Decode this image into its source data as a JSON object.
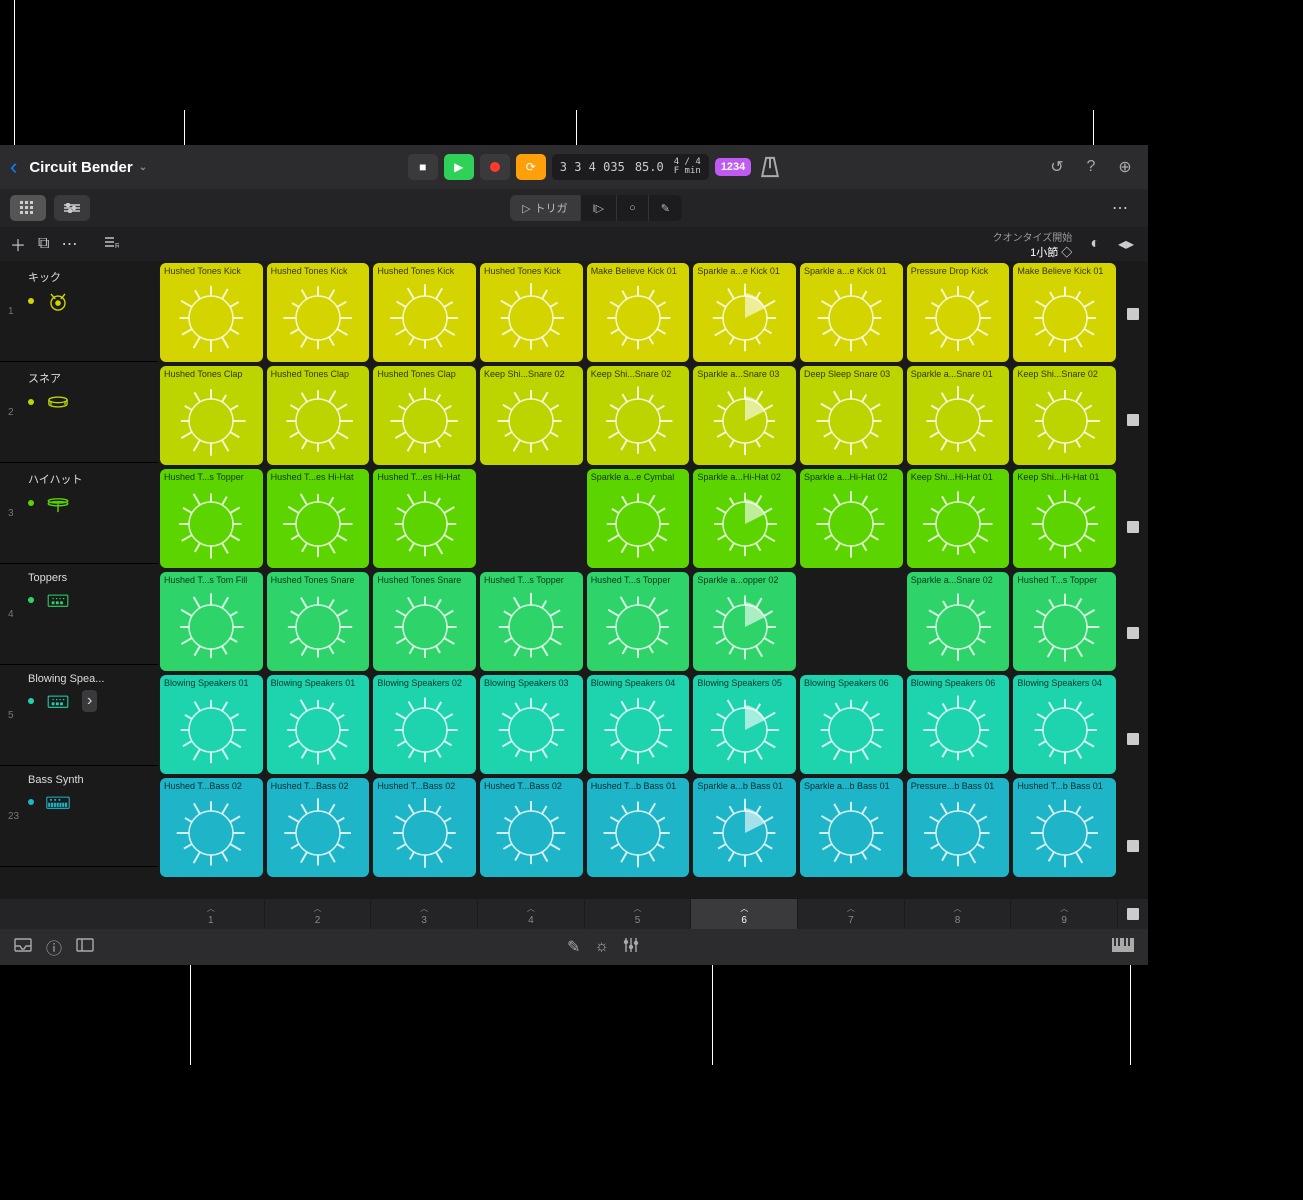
{
  "project": {
    "title": "Circuit Bender"
  },
  "transport": {
    "position": "3 3 4 035",
    "tempo": "85.0",
    "timesig": "4 / 4",
    "key": "F min",
    "countin": "1234"
  },
  "modes": {
    "trigger": "トリガ"
  },
  "quantize": {
    "label": "クオンタイズ開始",
    "value": "1小節"
  },
  "tracks": [
    {
      "num": "1",
      "name": "キック",
      "color": "#d4d400",
      "icon": "kick"
    },
    {
      "num": "2",
      "name": "スネア",
      "color": "#bcd400",
      "icon": "snare"
    },
    {
      "num": "3",
      "name": "ハイハット",
      "color": "#5cd400",
      "icon": "hihat"
    },
    {
      "num": "4",
      "name": "Toppers",
      "color": "#2ed46a",
      "icon": "pad"
    },
    {
      "num": "5",
      "name": "Blowing Spea...",
      "color": "#1ed4af",
      "icon": "pad",
      "expand": true
    },
    {
      "num": "23",
      "name": "Bass Synth",
      "color": "#1eb5c8",
      "icon": "synth"
    }
  ],
  "grid": [
    {
      "color": "#d4d400",
      "cells": [
        {
          "l": "Hushed Tones Kick"
        },
        {
          "l": "Hushed Tones Kick"
        },
        {
          "l": "Hushed Tones Kick"
        },
        {
          "l": "Hushed Tones Kick"
        },
        {
          "l": "Make Believe Kick 01"
        },
        {
          "l": "Sparkle a...e Kick 01",
          "play": true
        },
        {
          "l": "Sparkle a...e Kick 01"
        },
        {
          "l": "Pressure Drop Kick"
        },
        {
          "l": "Make Believe Kick 01"
        }
      ]
    },
    {
      "color": "#bcd400",
      "cells": [
        {
          "l": "Hushed Tones Clap"
        },
        {
          "l": "Hushed Tones Clap"
        },
        {
          "l": "Hushed Tones Clap"
        },
        {
          "l": "Keep Shi...Snare 02"
        },
        {
          "l": "Keep Shi...Snare 02"
        },
        {
          "l": "Sparkle a...Snare 03",
          "play": true
        },
        {
          "l": "Deep Sleep Snare 03"
        },
        {
          "l": "Sparkle a...Snare 01"
        },
        {
          "l": "Keep Shi...Snare 02"
        }
      ]
    },
    {
      "color": "#5cd400",
      "cells": [
        {
          "l": "Hushed T...s Topper"
        },
        {
          "l": "Hushed T...es Hi-Hat"
        },
        {
          "l": "Hushed T...es Hi-Hat"
        },
        {
          "empty": true
        },
        {
          "l": "Sparkle a...e Cymbal"
        },
        {
          "l": "Sparkle a...Hi-Hat 02",
          "play": true
        },
        {
          "l": "Sparkle a...Hi-Hat 02"
        },
        {
          "l": "Keep Shi...Hi-Hat 01"
        },
        {
          "l": "Keep Shi...Hi-Hat 01"
        }
      ]
    },
    {
      "color": "#2ed46a",
      "cells": [
        {
          "l": "Hushed T...s Tom Fill"
        },
        {
          "l": "Hushed Tones Snare"
        },
        {
          "l": "Hushed Tones Snare"
        },
        {
          "l": "Hushed T...s Topper"
        },
        {
          "l": "Hushed T...s Topper"
        },
        {
          "l": "Sparkle a...opper 02",
          "play": true
        },
        {
          "empty": true
        },
        {
          "l": "Sparkle a...Snare 02"
        },
        {
          "l": "Hushed T...s Topper"
        }
      ]
    },
    {
      "color": "#1ed4af",
      "cells": [
        {
          "l": "Blowing Speakers 01"
        },
        {
          "l": "Blowing Speakers 01"
        },
        {
          "l": "Blowing Speakers 02"
        },
        {
          "l": "Blowing Speakers 03"
        },
        {
          "l": "Blowing Speakers 04"
        },
        {
          "l": "Blowing Speakers 05",
          "play": true
        },
        {
          "l": "Blowing Speakers 06"
        },
        {
          "l": "Blowing Speakers 06"
        },
        {
          "l": "Blowing Speakers 04"
        }
      ]
    },
    {
      "color": "#1eb5c8",
      "cells": [
        {
          "l": "Hushed T...Bass 02"
        },
        {
          "l": "Hushed T...Bass 02"
        },
        {
          "l": "Hushed T...Bass 02"
        },
        {
          "l": "Hushed T...Bass 02"
        },
        {
          "l": "Hushed T...b Bass 01"
        },
        {
          "l": "Sparkle a...b Bass 01",
          "play": true
        },
        {
          "l": "Sparkle a...b Bass 01"
        },
        {
          "l": "Pressure...b Bass 01"
        },
        {
          "l": "Hushed T...b Bass 01"
        }
      ]
    }
  ],
  "scenes": [
    "1",
    "2",
    "3",
    "4",
    "5",
    "6",
    "7",
    "8",
    "9"
  ],
  "activeScene": 5
}
